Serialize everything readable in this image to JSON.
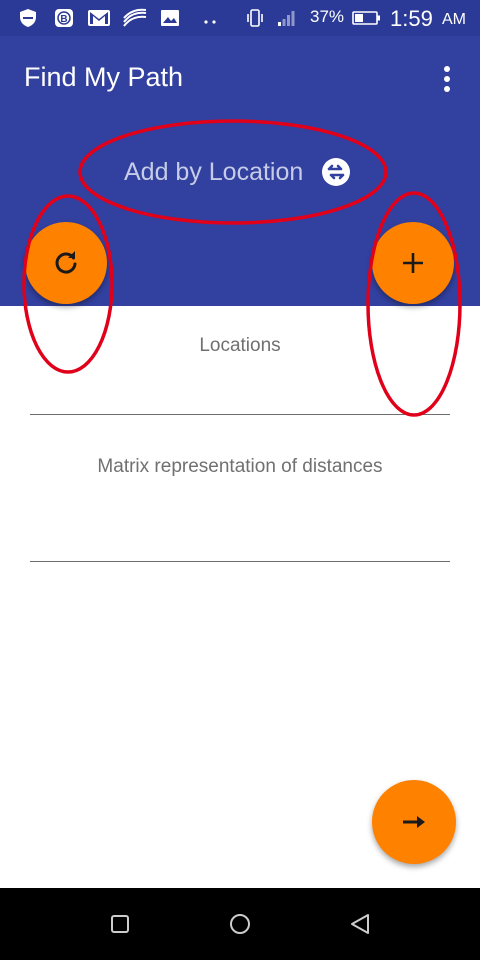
{
  "status_bar": {
    "icons": [
      "shield-icon",
      "b-app-icon",
      "gmail-icon",
      "swiftkey-icon",
      "image-icon",
      "more-dots-icon",
      "vibrate-icon",
      "signal-icon",
      "battery-icon"
    ],
    "battery_percent": "37%",
    "time": "1:59",
    "ampm": "AM"
  },
  "app_bar": {
    "title": "Find My Path",
    "overflow_icon": "more-vert-icon"
  },
  "mode_toggle": {
    "label": "Add by Location",
    "icon": "swap-horizontal-icon"
  },
  "buttons": {
    "refresh_icon": "refresh-icon",
    "add_icon": "add-icon",
    "next_icon": "arrow-right-icon"
  },
  "fields": {
    "locations_hint": "Locations",
    "matrix_hint": "Matrix representation of distances"
  },
  "nav_bar": {
    "icons": [
      "recents-square-icon",
      "home-circle-icon",
      "back-triangle-icon"
    ]
  },
  "colors": {
    "primary": "#3240a0",
    "status_bar": "#2a3a96",
    "accent": "#ff8100",
    "annotation": "#e0001a"
  }
}
